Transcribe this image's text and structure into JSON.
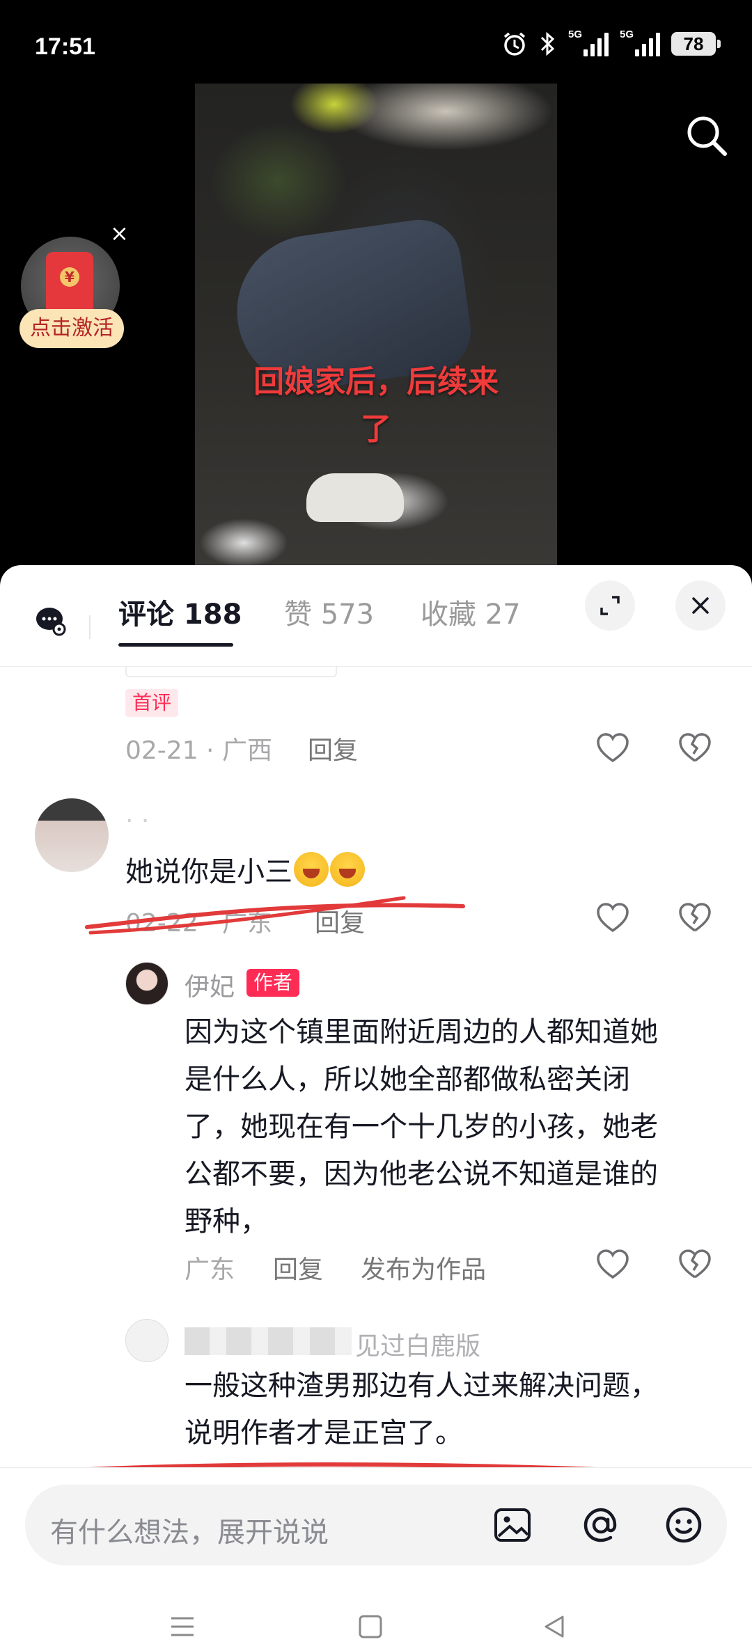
{
  "status_bar": {
    "time": "17:51",
    "signal1_label": "5G",
    "signal2_label": "5G",
    "battery": "78"
  },
  "video": {
    "caption_line1": "回娘家后，后续来",
    "caption_line2": "了"
  },
  "red_packet": {
    "label": "点击激活",
    "close": "×"
  },
  "tabs": {
    "comments": "评论 188",
    "likes": "赞 573",
    "favorites": "收藏 27"
  },
  "comments": {
    "c1": {
      "badge": "首评",
      "meta": "02-21 · 广西",
      "reply": "回复"
    },
    "c2": {
      "name": "· ·",
      "text": "她说你是小三",
      "meta": "02-22 · 广东",
      "reply": "回复"
    },
    "r1": {
      "name": "伊妃",
      "badge": "作者",
      "lines": [
        "因为这个镇里面附近周边的人都知道她",
        "是什么人，所以她全部都做私密关闭",
        "了，她现在有一个十几岁的小孩，她老",
        "公都不要，因为他老公说不知道是谁的",
        "野种，"
      ],
      "meta": "广东",
      "reply": "回复",
      "publish": "发布为作品"
    },
    "r2": {
      "name": "见过白鹿版",
      "lines": [
        "一般这种渣男那边有人过来解决问题，",
        "说明作者才是正宫了。"
      ]
    }
  },
  "input": {
    "placeholder": "有什么想法，展开说说"
  },
  "colors": {
    "accent": "#fe2c55",
    "caption": "#ef3b3b",
    "scribble": "#e23a3a"
  }
}
